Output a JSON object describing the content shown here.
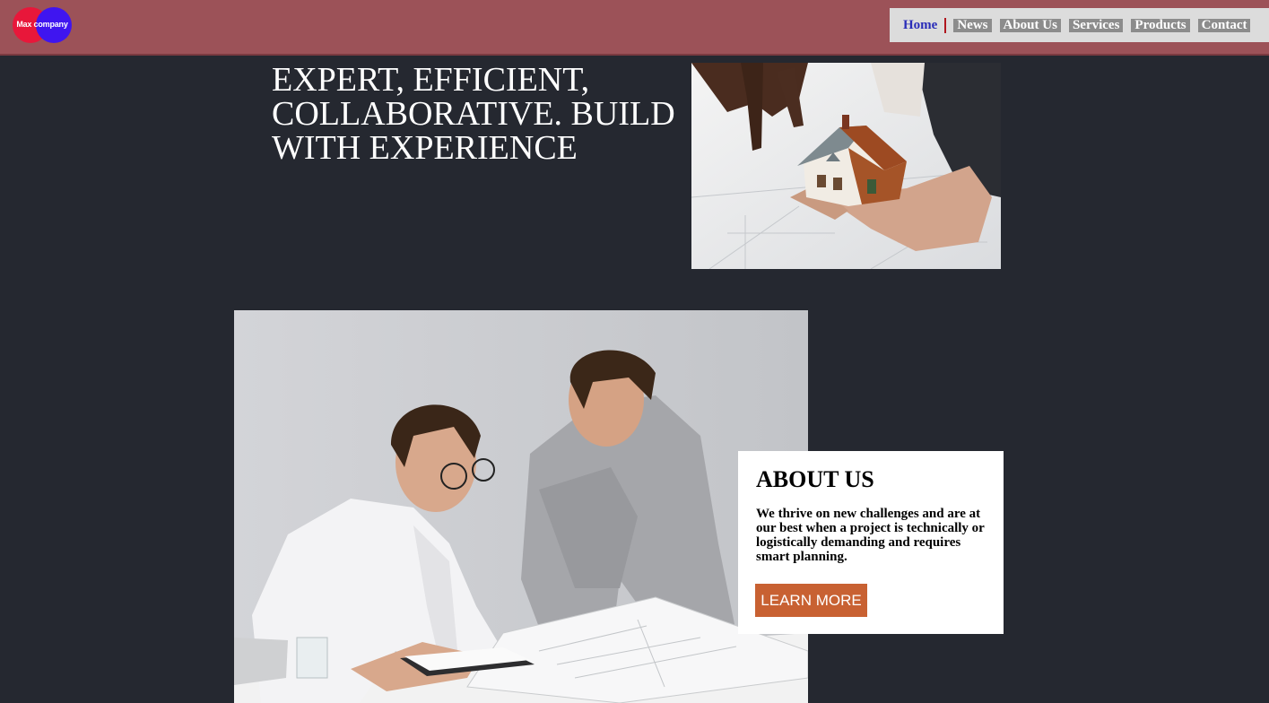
{
  "header": {
    "logo_text": "Max company",
    "nav": {
      "home": "Home",
      "items": [
        "News",
        "About Us",
        "Services",
        "Products",
        "Contact"
      ]
    }
  },
  "hero": {
    "title": "EXPERT, EFFICIENT, COLLABORATIVE. BUILD WITH EXPERIENCE"
  },
  "about": {
    "title": "ABOUT US",
    "text": "We thrive on new challenges and are at our best when a project is technically or logistically demanding and requires smart planning.",
    "button_label": "LEARN MORE"
  },
  "colors": {
    "header_bg": "#9c5258",
    "page_bg": "#252830",
    "nav_bg": "#dcdcdc",
    "nav_item_bg": "#8c8c8c",
    "home_link": "#2a2db8",
    "button_bg": "#c86132",
    "logo_red": "#e8173a",
    "logo_blue": "#3f15f0"
  },
  "icons": {
    "logo": "max-company-logo"
  }
}
